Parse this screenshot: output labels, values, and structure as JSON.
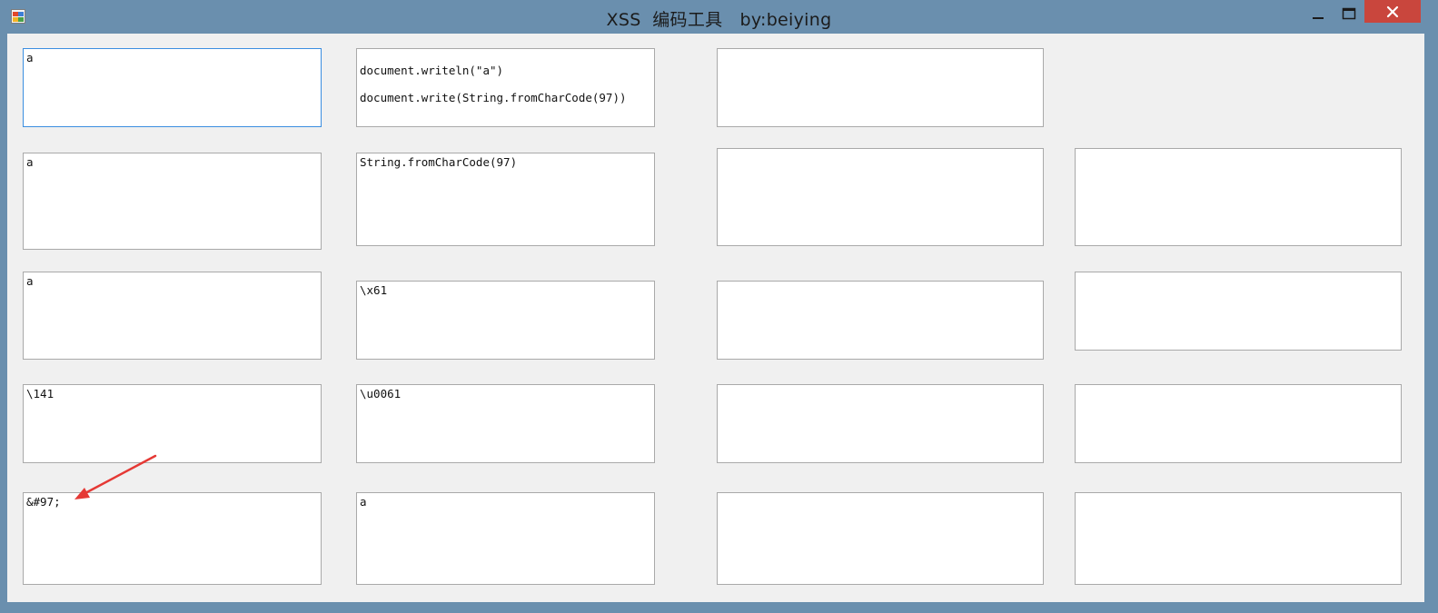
{
  "window": {
    "title": "XSS  编码工具   by:beiying",
    "controls": {
      "minimize": "minimize",
      "maximize": "maximize",
      "close": "close"
    }
  },
  "boxes": {
    "r1c1": "a",
    "r1c2_line1": "document.writeln(\"a\")",
    "r1c2_line2": "document.write(String.fromCharCode(97))",
    "r1c3": "",
    "r2c1": "a",
    "r2c2": "String.fromCharCode(97)",
    "r2c3": "",
    "r2c4": "",
    "r3c1": "a",
    "r3c2": "\\x61",
    "r3c3": "",
    "r3c4": "",
    "r4c1": "\\141",
    "r4c2": "\\u0061",
    "r4c3": "",
    "r4c4": "",
    "r5c1": "&#97;",
    "r5c2": "a",
    "r5c3": "",
    "r5c4": ""
  },
  "annotation": {
    "arrow_color": "#e53935"
  }
}
